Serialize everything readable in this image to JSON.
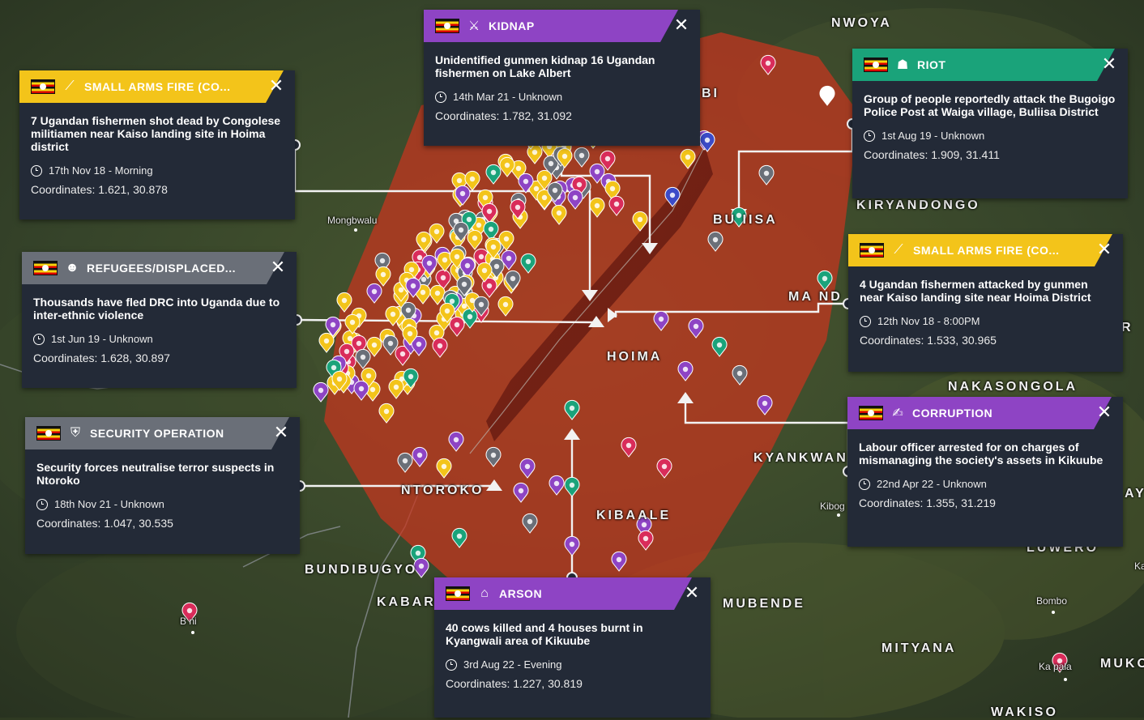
{
  "places": [
    {
      "id": "nwoya",
      "text": "NWOYA",
      "size": "big"
    },
    {
      "id": "kiryandongo",
      "text": "KIRYANDONGO",
      "size": "big"
    },
    {
      "id": "buliisa",
      "text": "BU  IISA",
      "size": "big"
    },
    {
      "id": "hoima",
      "text": "HOIMA",
      "size": "big"
    },
    {
      "id": "masindi",
      "text": "MA  ND",
      "size": "big"
    },
    {
      "id": "nakasongola",
      "text": "NAKASONGOLA",
      "size": "big"
    },
    {
      "id": "kyankwanzi",
      "text": "KYANKWAN",
      "size": "big"
    },
    {
      "id": "kibaale",
      "text": "KIBAALE",
      "size": "big"
    },
    {
      "id": "ntoroko",
      "text": "NTOROKO",
      "size": "big"
    },
    {
      "id": "bundibugyo",
      "text": "BUNDIBUGYO",
      "size": "big"
    },
    {
      "id": "kabarole",
      "text": "KABAR",
      "size": "big"
    },
    {
      "id": "mubende",
      "text": "MUBENDE",
      "size": "big"
    },
    {
      "id": "mityana",
      "text": "MITYANA",
      "size": "big"
    },
    {
      "id": "wakiso",
      "text": "WAKISO",
      "size": "big"
    },
    {
      "id": "mukono",
      "text": "MUKO",
      "size": "big"
    },
    {
      "id": "luwero",
      "text": "LUWERO",
      "size": "big"
    },
    {
      "id": "bi",
      "text": "BI",
      "size": "big"
    },
    {
      "id": "r",
      "text": "R",
      "size": "big"
    },
    {
      "id": "ay",
      "text": "AY",
      "size": "big"
    },
    {
      "id": "mongbwalu",
      "text": "Mongbwalu",
      "size": "small"
    },
    {
      "id": "kiboga",
      "text": "Kibog",
      "size": "small"
    },
    {
      "id": "bombo",
      "text": "Bombo",
      "size": "small"
    },
    {
      "id": "beni",
      "text": "B  ni",
      "size": "small"
    },
    {
      "id": "kampala",
      "text": "Ka    pala",
      "size": "small"
    },
    {
      "id": "ka",
      "text": "Ka",
      "size": "small"
    }
  ],
  "colors": {
    "yellow": "#f3c41a",
    "grey": "#6a6f78",
    "purple": "#8e44c4",
    "green": "#1aa37a",
    "card_bg": "#232a37",
    "heat": "#c8341e"
  },
  "events": [
    {
      "id": "kidnap",
      "category": "KIDNAP",
      "icon": "kidnap-icon",
      "glyph": "⚔",
      "color": "purple",
      "title": "Unidentified gunmen kidnap 16 Ugandan fishermen on Lake Albert",
      "time": "14th Mar 21 - Unknown",
      "coords": "Coordinates: 1.782, 31.092"
    },
    {
      "id": "saf1",
      "category": "SMALL ARMS FIRE (CO...",
      "icon": "rifle-icon",
      "glyph": "⟋",
      "color": "yellow",
      "title": "7 Ugandan fishermen shot dead by Congolese militiamen near Kaiso landing site in Hoima district",
      "time": "17th Nov 18 - Morning",
      "coords": "Coordinates: 1.621, 30.878"
    },
    {
      "id": "riot",
      "category": "RIOT",
      "icon": "crowd-icon",
      "glyph": "☗",
      "color": "green",
      "title": "Group of people reportedly attack the Bugoigo Police Post at Waiga village, Buliisa District",
      "time": "1st Aug 19 - Unknown",
      "coords": "Coordinates: 1.909, 31.411"
    },
    {
      "id": "refugees",
      "category": "REFUGEES/DISPLACED...",
      "icon": "refugees-icon",
      "glyph": "☻",
      "color": "grey",
      "title": "Thousands have fled DRC into Uganda due to inter-ethnic violence",
      "time": "1st Jun 19 - Unknown",
      "coords": "Coordinates: 1.628, 30.897"
    },
    {
      "id": "saf2",
      "category": "SMALL ARMS FIRE (CO...",
      "icon": "rifle-icon",
      "glyph": "⟋",
      "color": "yellow",
      "title": "4 Ugandan fishermen attacked by gunmen near Kaiso landing site near Hoima District",
      "time": "12th Nov 18 - 8:00PM",
      "coords": "Coordinates: 1.533, 30.965"
    },
    {
      "id": "security",
      "category": "SECURITY OPERATION",
      "icon": "shield-icon",
      "glyph": "⛨",
      "color": "grey",
      "title": "Security forces neutralise terror suspects in Ntoroko",
      "time": "18th Nov 21 - Unknown",
      "coords": "Coordinates: 1.047, 30.535"
    },
    {
      "id": "corruption",
      "category": "CORRUPTION",
      "icon": "handshake-icon",
      "glyph": "✍",
      "color": "purple",
      "title": "Labour officer arrested for on charges of mismanaging the society's assets in Kikuube",
      "time": "22nd Apr 22 - Unknown",
      "coords": "Coordinates: 1.355, 31.219"
    },
    {
      "id": "arson",
      "category": "ARSON",
      "icon": "house-icon",
      "glyph": "⌂",
      "color": "purple",
      "title": "40 cows killed and 4 houses burnt in Kyangwali area of Kikuube",
      "time": "3rd Aug 22 - Evening",
      "coords": "Coordinates: 1.227, 30.819"
    }
  ]
}
